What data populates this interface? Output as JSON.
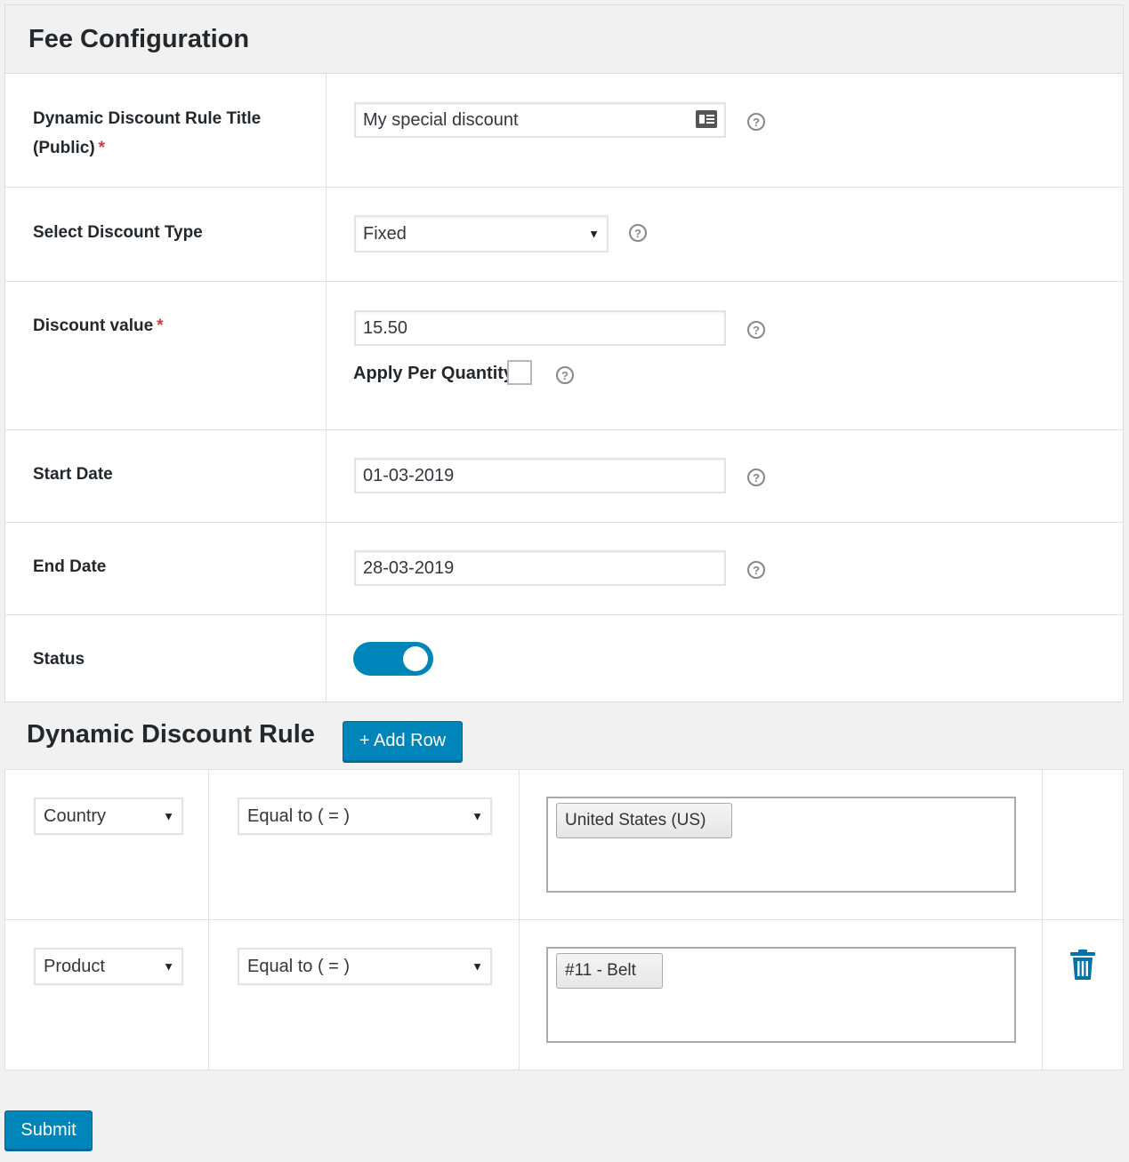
{
  "header": {
    "title": "Fee Configuration"
  },
  "fields": {
    "rule_title": {
      "label": "Dynamic Discount Rule Title (Public)",
      "required_mark": "*",
      "value": "My special discount"
    },
    "discount_type": {
      "label": "Select Discount Type",
      "value": "Fixed"
    },
    "discount_value": {
      "label": "Discount value",
      "required_mark": "*",
      "value": "15.50"
    },
    "apply_per_quantity": {
      "label": "Apply Per Quantity",
      "checked": false
    },
    "start_date": {
      "label": "Start Date",
      "value": "01-03-2019"
    },
    "end_date": {
      "label": "End Date",
      "value": "28-03-2019"
    },
    "status": {
      "label": "Status",
      "enabled": true
    }
  },
  "help_icon_text": "?",
  "rules_section": {
    "title": "Dynamic Discount Rule",
    "add_row_label": "+ Add Row",
    "rows": [
      {
        "condition": "Country",
        "operator": "Equal to ( = )",
        "values": [
          "United States (US)"
        ]
      },
      {
        "condition": "Product",
        "operator": "Equal to ( = )",
        "values": [
          "#11 - Belt"
        ]
      }
    ]
  },
  "submit_label": "Submit",
  "colors": {
    "primary": "#0085ba",
    "required": "#dc3232"
  }
}
